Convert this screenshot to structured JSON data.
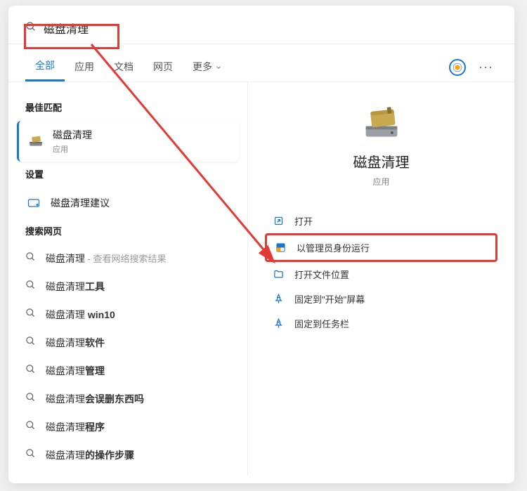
{
  "search": {
    "query": "磁盘清理"
  },
  "tabs": {
    "all": "全部",
    "apps": "应用",
    "docs": "文档",
    "web": "网页",
    "more": "更多"
  },
  "sections": {
    "best_match": "最佳匹配",
    "settings": "设置",
    "search_web": "搜索网页"
  },
  "best_match": {
    "title": "磁盘清理",
    "sub": "应用"
  },
  "settings_item": {
    "title": "磁盘清理建议"
  },
  "web_items": [
    {
      "prefix": "磁盘清理",
      "bold": "",
      "hint": " - 查看网络搜索结果"
    },
    {
      "prefix": "磁盘清理",
      "bold": "工具",
      "hint": ""
    },
    {
      "prefix": "磁盘清理 ",
      "bold": "win10",
      "hint": ""
    },
    {
      "prefix": "磁盘清理",
      "bold": "软件",
      "hint": ""
    },
    {
      "prefix": "磁盘清理",
      "bold": "管理",
      "hint": ""
    },
    {
      "prefix": "磁盘清理",
      "bold": "会误删东西吗",
      "hint": ""
    },
    {
      "prefix": "磁盘清理",
      "bold": "程序",
      "hint": ""
    },
    {
      "prefix": "磁盘清理",
      "bold": "的操作步骤",
      "hint": ""
    }
  ],
  "preview": {
    "title": "磁盘清理",
    "sub": "应用"
  },
  "actions": {
    "open": "打开",
    "run_admin": "以管理员身份运行",
    "open_location": "打开文件位置",
    "pin_start": "固定到\"开始\"屏幕",
    "pin_taskbar": "固定到任务栏"
  }
}
